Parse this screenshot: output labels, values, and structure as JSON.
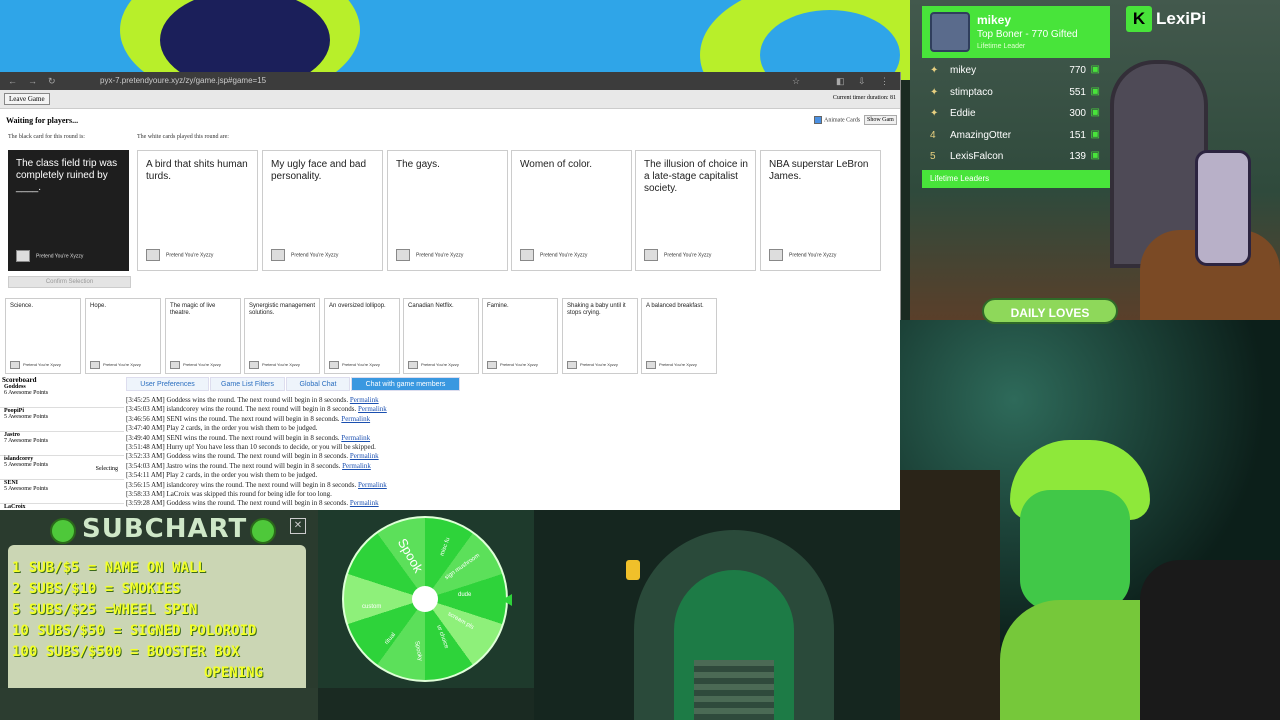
{
  "browser": {
    "url": "pyx-7.pretendyoure.xyz/zy/game.jsp#game=15",
    "leave_button": "Leave Game",
    "timer": "Current timer duration: 81",
    "status": "Waiting for players...",
    "black_caption": "The black card for this round is:",
    "white_caption": "The white cards played this round are:",
    "animate_cards": "Animate Cards",
    "show_game": "Show Gam",
    "confirm_button": "Confirm Selection",
    "card_footer": "Pretend You're Xyzzy",
    "black_card": "The class field trip was completely ruined by ____.",
    "played_cards": [
      "A bird that shits human turds.",
      "My ugly face and bad personality.",
      "The gays.",
      "Women of color.",
      "The illusion of choice in a late-stage capitalist society.",
      "NBA superstar LeBron James."
    ],
    "hand_cards": [
      "Science.",
      "Hope.",
      "The magic of live theatre.",
      "Synergistic management solutions.",
      "An oversized lollipop.",
      "Canadian Netflix.",
      "Famine.",
      "Shaking a baby until it stops crying.",
      "A balanced breakfast."
    ],
    "scoreboard": {
      "title": "Scoreboard",
      "rows": [
        {
          "name": "Goddess",
          "points": "6 Awesome Points",
          "status": ""
        },
        {
          "name": "PoopiPi",
          "points": "5 Awesome Points",
          "status": ""
        },
        {
          "name": "Jastro",
          "points": "7 Awesome Points",
          "status": ""
        },
        {
          "name": "islandcorey",
          "points": "5 Awesome Points",
          "status": "Selecting"
        },
        {
          "name": "SENI",
          "points": "5 Awesome Points",
          "status": ""
        },
        {
          "name": "LaCroix",
          "points": "",
          "status": ""
        }
      ]
    },
    "tabs": [
      "User Preferences",
      "Game List Filters",
      "Global Chat",
      "Chat with game members"
    ],
    "chat": [
      {
        "text": "[3:45:25 AM] Goddess wins the round. The next round will begin in 8 seconds. ",
        "link": "Permalink"
      },
      {
        "text": "[3:45:03 AM] islandcorey wins the round. The next round will begin in 8 seconds. ",
        "link": "Permalink"
      },
      {
        "text": "[3:46:56 AM] SENI wins the round. The next round will begin in 8 seconds. ",
        "link": "Permalink"
      },
      {
        "text": "[3:47:40 AM] Play 2 cards, in the order you wish them to be judged.",
        "link": ""
      },
      {
        "text": "[3:49:40 AM] SENI wins the round. The next round will begin in 8 seconds. ",
        "link": "Permalink"
      },
      {
        "text": "[3:51:48 AM] Hurry up! You have less than 10 seconds to decide, or you will be skipped.",
        "link": ""
      },
      {
        "text": "[3:52:33 AM] Goddess wins the round. The next round will begin in 8 seconds. ",
        "link": "Permalink"
      },
      {
        "text": "[3:54:03 AM] Jastro wins the round. The next round will begin in 8 seconds. ",
        "link": "Permalink"
      },
      {
        "text": "[3:54:11 AM] Play 2 cards, in the order you wish them to be judged.",
        "link": ""
      },
      {
        "text": "[3:56:15 AM] islandcorey wins the round. The next round will begin in 8 seconds. ",
        "link": "Permalink"
      },
      {
        "text": "[3:58:33 AM] LaCroix was skipped this round for being idle for too long.",
        "link": ""
      },
      {
        "text": "[3:59:28 AM] Goddess wins the round. The next round will begin in 8 seconds. ",
        "link": "Permalink"
      }
    ]
  },
  "overlay": {
    "logo": "LexiPi",
    "top_leader": {
      "name": "mikey",
      "subtitle": "Top Boner - 770 Gifted",
      "caption": "Lifetime Leader"
    },
    "leaders": [
      {
        "rank": "",
        "name": "mikey",
        "score": "770"
      },
      {
        "rank": "",
        "name": "stimptaco",
        "score": "551"
      },
      {
        "rank": "",
        "name": "Eddie",
        "score": "300"
      },
      {
        "rank": "4",
        "name": "AmazingOtter",
        "score": "151"
      },
      {
        "rank": "5",
        "name": "LexisFalcon",
        "score": "139"
      }
    ],
    "leaders_footer": "Lifetime Leaders",
    "daily_loves": "DAILY LOVES"
  },
  "subchart": {
    "title": "SUBCHART",
    "lines": [
      "1 SUB/$5 = NAME ON WALL",
      "2 SUBS/$10 = SMOKIES",
      "5 SUBS/$25 =WHEEL SPIN",
      "10 SUBS/$50 = SIGNED POLOROID",
      "100 SUBS/$500 = BOOSTER BOX",
      "OPENING"
    ]
  },
  "wheel": {
    "center_label": "Spook",
    "labels": [
      "misc fu",
      "sign mushroom",
      "dude",
      "scream pls",
      "ur choice",
      "custom",
      "ritual",
      "Spooky"
    ]
  }
}
